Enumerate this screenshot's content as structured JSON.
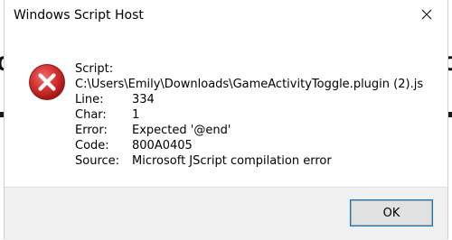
{
  "window": {
    "title": "Windows Script Host",
    "close_icon": "close-icon"
  },
  "message": {
    "icon": "error-icon",
    "script_label": "Script:",
    "script_path": "C:\\Users\\Emily\\Downloads\\GameActivityToggle.plugin (2).js",
    "fields": [
      {
        "label": "Line:",
        "value": "334"
      },
      {
        "label": "Char:",
        "value": "1"
      },
      {
        "label": "Error:",
        "value": "Expected '@end'"
      },
      {
        "label": "Code:",
        "value": "800A0405"
      },
      {
        "label": "Source:",
        "value": "Microsoft JScript compilation error"
      }
    ]
  },
  "buttons": {
    "ok_label": "OK"
  },
  "colors": {
    "error_red": "#d32f2f",
    "focus_blue": "#0078d7",
    "footer_bg": "#f0f0f0"
  }
}
